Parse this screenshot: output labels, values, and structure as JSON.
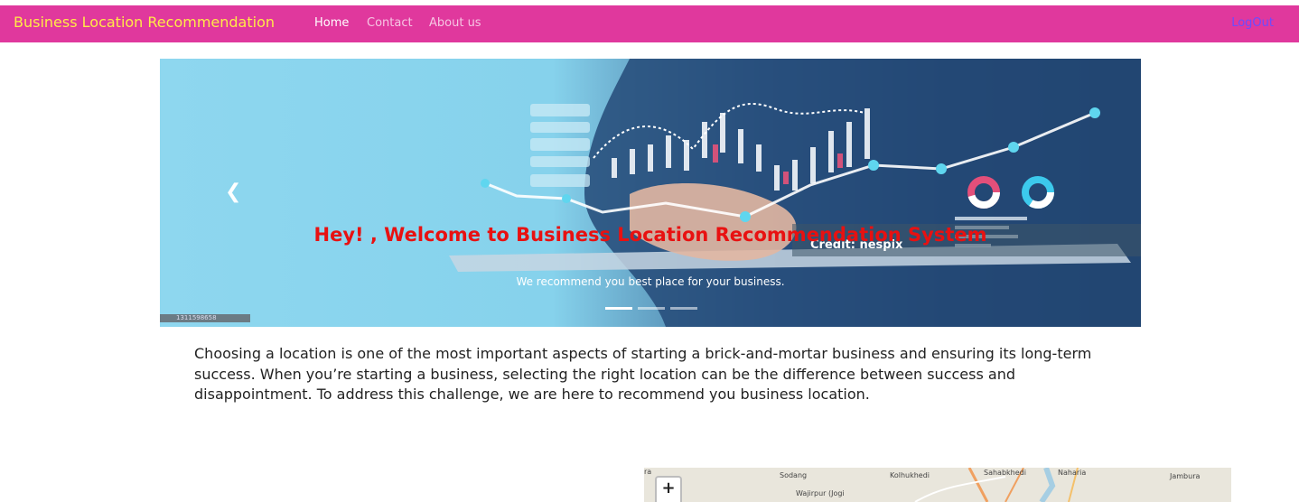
{
  "navbar": {
    "brand": "Business Location Recommendation",
    "links": [
      {
        "label": "Home",
        "active": true
      },
      {
        "label": "Contact",
        "active": false
      },
      {
        "label": "About us",
        "active": false
      }
    ],
    "logout": "LogOut"
  },
  "carousel": {
    "title": "Hey! , Welcome to Business Location Recommendation System",
    "subtitle": "We recommend you best place for your business.",
    "credit": "Credit: nespix",
    "stock_id": "1311598658",
    "slide_count": 3,
    "active_slide": 1,
    "prev_icon": "chevron-left-icon"
  },
  "description": "Choosing a location is one of the most important aspects of starting a brick-and-mortar business and ensuring its long-term success. When you’re starting a business, selecting the right location can be the difference between success and disappointment. To address this challenge, we are here to recommend you business location.",
  "map": {
    "zoom_in": "+",
    "labels": [
      "ra",
      "Sodang",
      "Kolhukhedi",
      "Sahabkhedi",
      "Naharia",
      "Jambura",
      "Wajirpur (Jogi"
    ]
  },
  "colors": {
    "navbar": "#e0389d",
    "brand": "#ffea47",
    "logout": "#6a4cff",
    "caption_title": "#e81111"
  }
}
